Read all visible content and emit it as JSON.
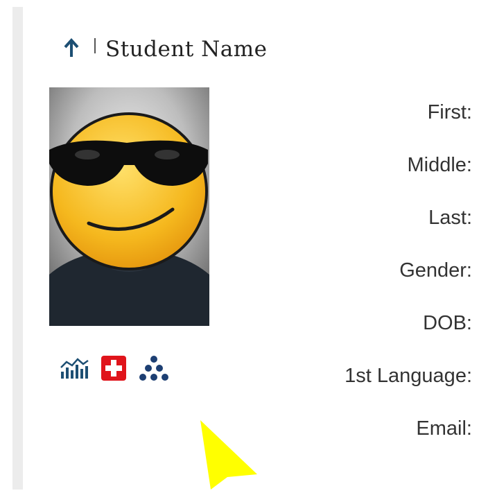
{
  "header": {
    "title": "Student Name"
  },
  "fields": [
    {
      "label": "First:"
    },
    {
      "label": "Middle:"
    },
    {
      "label": "Last:"
    },
    {
      "label": "Gender:"
    },
    {
      "label": "DOB:"
    },
    {
      "label": "1st Language:"
    },
    {
      "label": "Email:"
    }
  ],
  "icons": [
    "sort-up-arrow-icon",
    "chart-icon",
    "medical-cross-icon",
    "group-dots-icon",
    "pointer-cursor-icon"
  ],
  "colors": {
    "arrow": "#1d4f73",
    "chart": "#1d4f73",
    "medical": "#e0141b",
    "dots": "#1d3f73",
    "cursor": "#ffff00",
    "rail": "#ececec"
  }
}
